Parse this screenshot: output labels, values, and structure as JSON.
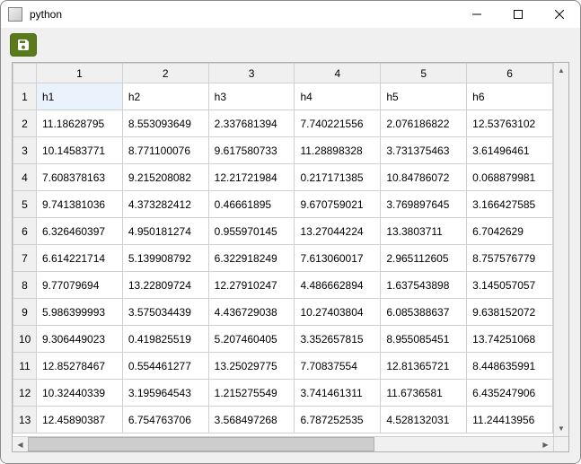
{
  "window": {
    "title": "python"
  },
  "toolbar": {
    "save_icon": "save-icon"
  },
  "table": {
    "col_headers": [
      "1",
      "2",
      "3",
      "4",
      "5",
      "6"
    ],
    "row_headers": [
      "1",
      "2",
      "3",
      "4",
      "5",
      "6",
      "7",
      "8",
      "9",
      "10",
      "11",
      "12",
      "13"
    ],
    "selected_cell": [
      0,
      0
    ],
    "rows": [
      [
        "h1",
        "h2",
        "h3",
        "h4",
        "h5",
        "h6"
      ],
      [
        "11.18628795",
        "8.553093649",
        "2.337681394",
        "7.740221556",
        "2.076186822",
        "12.53763102"
      ],
      [
        "10.14583771",
        "8.771100076",
        "9.617580733",
        "11.28898328",
        "3.731375463",
        "3.61496461"
      ],
      [
        "7.608378163",
        "9.215208082",
        "12.21721984",
        "0.217171385",
        "10.84786072",
        "0.068879981"
      ],
      [
        "9.741381036",
        "4.373282412",
        "0.46661895",
        "9.670759021",
        "3.769897645",
        "3.166427585"
      ],
      [
        "6.326460397",
        "4.950181274",
        "0.955970145",
        "13.27044224",
        "13.3803711",
        "6.7042629"
      ],
      [
        "6.614221714",
        "5.139908792",
        "6.322918249",
        "7.613060017",
        "2.965112605",
        "8.757576779"
      ],
      [
        "9.77079694",
        "13.22809724",
        "12.27910247",
        "4.486662894",
        "1.637543898",
        "3.145057057"
      ],
      [
        "5.986399993",
        "3.575034439",
        "4.436729038",
        "10.27403804",
        "6.085388637",
        "9.638152072"
      ],
      [
        "9.306449023",
        "0.419825519",
        "5.207460405",
        "3.352657815",
        "8.955085451",
        "13.74251068"
      ],
      [
        "12.85278467",
        "0.554461277",
        "13.25029775",
        "7.70837554",
        "12.81365721",
        "8.448635991"
      ],
      [
        "10.32440339",
        "3.195964543",
        "1.215275549",
        "3.741461311",
        "11.6736581",
        "6.435247906"
      ],
      [
        "12.45890387",
        "6.754763706",
        "3.568497268",
        "6.787252535",
        "4.528132031",
        "11.24413956"
      ]
    ]
  }
}
